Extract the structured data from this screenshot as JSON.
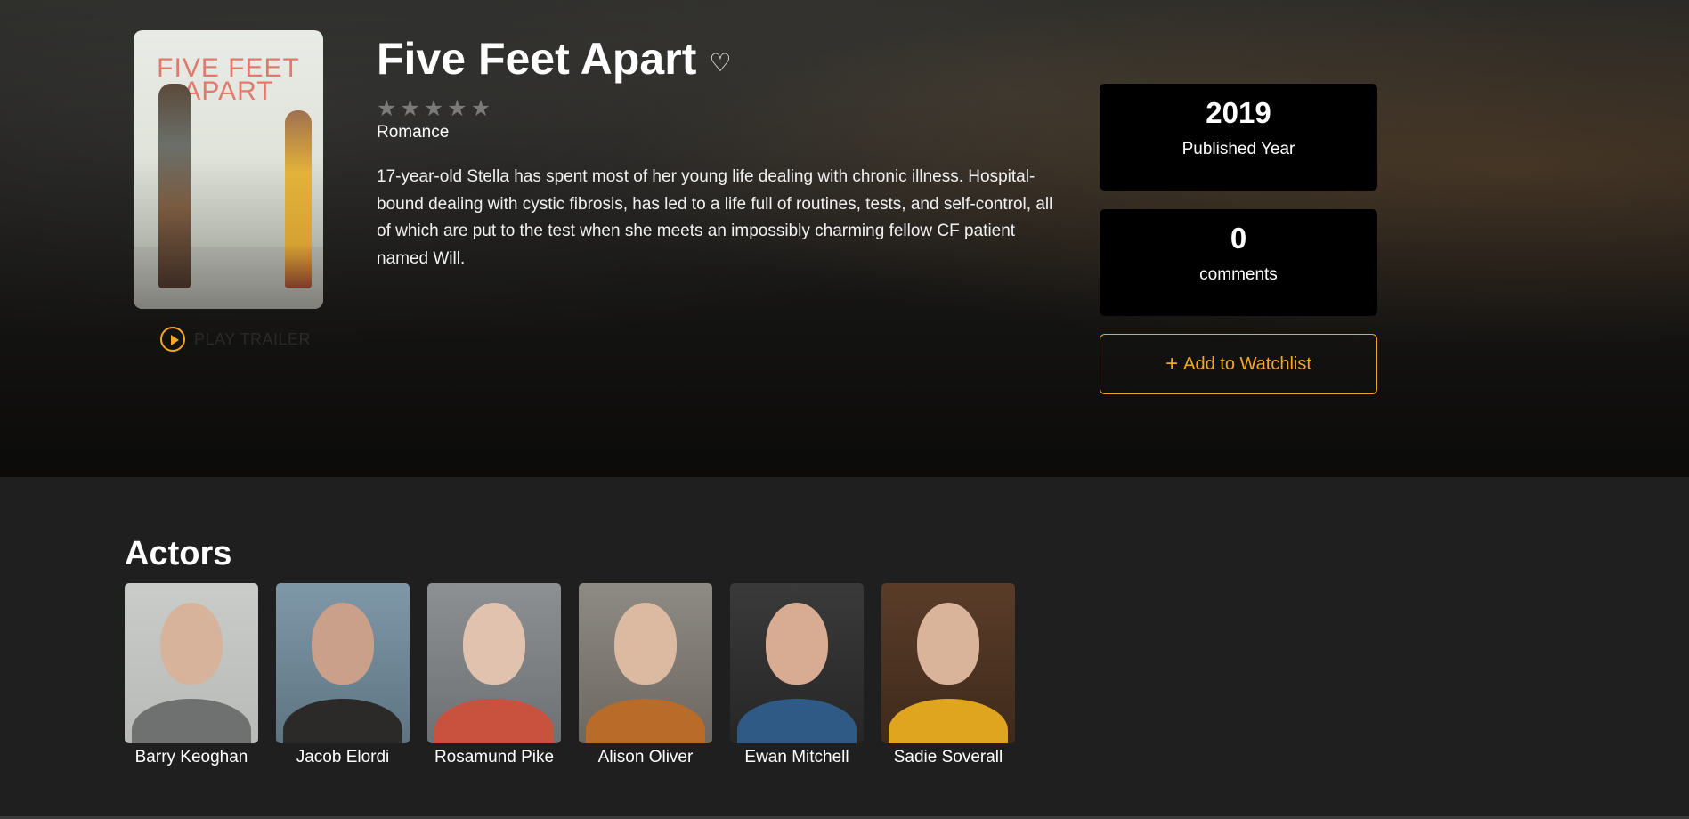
{
  "movie": {
    "title": "Five Feet Apart",
    "poster_text": "FIVE FEET APART",
    "rating_stars": 0,
    "rating_max": 5,
    "genre": "Romance",
    "description": "17-year-old Stella has spent most of her young life dealing with chronic illness. Hospital-bound dealing with cystic fibrosis, has led to a life full of routines, tests, and self-control, all of which are put to the test when she meets an impossibly charming fellow CF patient named Will.",
    "play_trailer_label": "PLAY TRAILER"
  },
  "stats": {
    "year_value": "2019",
    "year_label": "Published Year",
    "comments_value": "0",
    "comments_label": "comments"
  },
  "watchlist": {
    "label": "Add to Watchlist",
    "icon": "plus-icon",
    "color": "#f5a623"
  },
  "actors_section": {
    "title": "Actors",
    "actors": [
      {
        "name": "Barry Keoghan"
      },
      {
        "name": "Jacob Elordi"
      },
      {
        "name": "Rosamund Pike"
      },
      {
        "name": "Alison Oliver"
      },
      {
        "name": "Ewan Mitchell"
      },
      {
        "name": "Sadie Soverall"
      }
    ]
  },
  "colors": {
    "accent": "#f5a623",
    "background": "#1f1f1f",
    "stat_box": "#000000",
    "star_inactive": "#7a7a7a"
  }
}
